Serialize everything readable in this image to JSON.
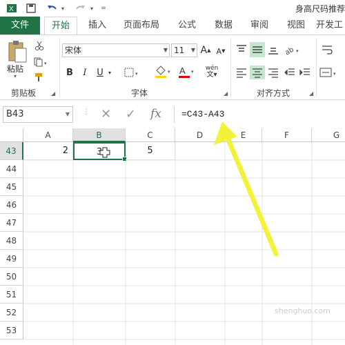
{
  "titlebar": {
    "document_title": "身高尺码推荐"
  },
  "ribbon": {
    "tabs": [
      {
        "label": "文件"
      },
      {
        "label": "开始"
      },
      {
        "label": "插入"
      },
      {
        "label": "页面布局"
      },
      {
        "label": "公式"
      },
      {
        "label": "数据"
      },
      {
        "label": "审阅"
      },
      {
        "label": "视图"
      },
      {
        "label": "开发工"
      }
    ],
    "clipboard": {
      "paste_label": "粘贴",
      "group_label": "剪贴板"
    },
    "font": {
      "font_name": "宋体",
      "font_size": "11",
      "group_label": "字体",
      "bold": "B",
      "italic": "I",
      "underline": "U",
      "phonetic": "wén",
      "grow": "A",
      "shrink": "A"
    },
    "alignment": {
      "group_label": "对齐方式"
    }
  },
  "formula_bar": {
    "name_box": "B43",
    "formula": "=C43-A43",
    "fx": "fx",
    "cancel": "✕",
    "enter": "✓"
  },
  "grid": {
    "columns": [
      "A",
      "B",
      "C",
      "D",
      "E",
      "F",
      "G"
    ],
    "rows": [
      "43",
      "44",
      "45",
      "46",
      "47",
      "48",
      "49",
      "50",
      "51",
      "52",
      "53"
    ],
    "row43": {
      "A": "2",
      "B": "3",
      "C": "5"
    }
  },
  "colors": {
    "accent": "#217346",
    "arrow": "#f2f23a",
    "selected_header": "#e1e1e1"
  },
  "watermark": "shenghuo.com"
}
